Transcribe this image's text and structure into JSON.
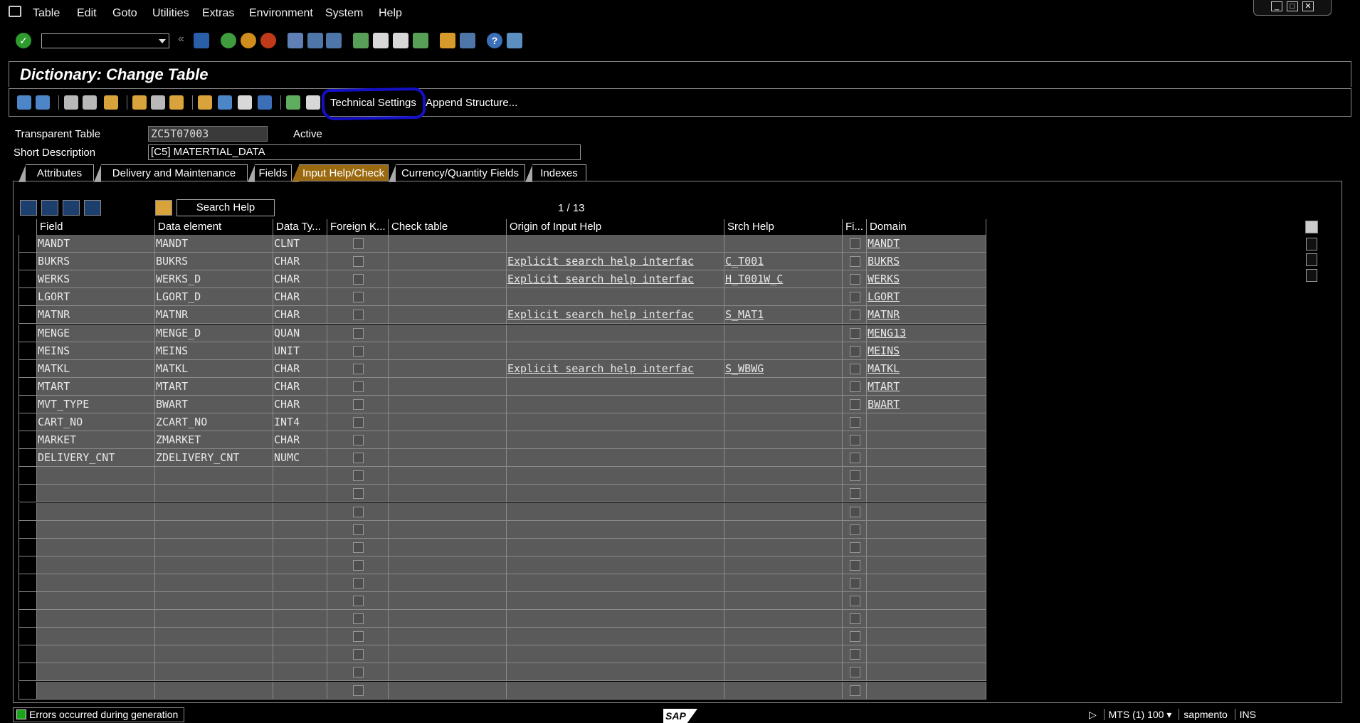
{
  "menu": {
    "items": [
      "Table",
      "Edit",
      "Goto",
      "Utilities",
      "Extras",
      "Environment",
      "System",
      "Help"
    ]
  },
  "title": "Dictionary: Change Table",
  "app_toolbar": {
    "technical_settings": "Technical Settings",
    "append_structure": "Append Structure..."
  },
  "header": {
    "transparent_table_label": "Transparent Table",
    "transparent_table_value": "ZC5T07003",
    "status": "Active",
    "short_description_label": "Short Description",
    "short_description_value": "[C5] MATERTIAL_DATA"
  },
  "tabs": [
    "Attributes",
    "Delivery and Maintenance",
    "Fields",
    "Input Help/Check",
    "Currency/Quantity Fields",
    "Indexes"
  ],
  "active_tab": "Input Help/Check",
  "table_toolbar": {
    "search_help": "Search Help",
    "pager": "1  /  13"
  },
  "columns": [
    "Field",
    "Data element",
    "Data Ty...",
    "Foreign K...",
    "Check table",
    "Origin of Input Help",
    "Srch Help",
    "Fi...",
    "Domain"
  ],
  "rows": [
    {
      "field": "MANDT",
      "data_element": "MANDT",
      "data_type": "CLNT",
      "check_table": "",
      "origin": "",
      "srch_help": "",
      "domain": "MANDT"
    },
    {
      "field": "BUKRS",
      "data_element": "BUKRS",
      "data_type": "CHAR",
      "check_table": "",
      "origin": "Explicit search help interfac",
      "srch_help": "C_T001",
      "domain": "BUKRS"
    },
    {
      "field": "WERKS",
      "data_element": "WERKS_D",
      "data_type": "CHAR",
      "check_table": "",
      "origin": "Explicit search help interfac",
      "srch_help": "H_T001W_C",
      "domain": "WERKS"
    },
    {
      "field": "LGORT",
      "data_element": "LGORT_D",
      "data_type": "CHAR",
      "check_table": "",
      "origin": "",
      "srch_help": "",
      "domain": "LGORT"
    },
    {
      "field": "MATNR",
      "data_element": "MATNR",
      "data_type": "CHAR",
      "check_table": "",
      "origin": "Explicit search help interfac",
      "srch_help": "S_MAT1",
      "domain": "MATNR"
    },
    {
      "field": "MENGE",
      "data_element": "MENGE_D",
      "data_type": "QUAN",
      "check_table": "",
      "origin": "",
      "srch_help": "",
      "domain": "MENG13"
    },
    {
      "field": "MEINS",
      "data_element": "MEINS",
      "data_type": "UNIT",
      "check_table": "",
      "origin": "",
      "srch_help": "",
      "domain": "MEINS"
    },
    {
      "field": "MATKL",
      "data_element": "MATKL",
      "data_type": "CHAR",
      "check_table": "",
      "origin": "Explicit search help interfac",
      "srch_help": "S_WBWG",
      "domain": "MATKL"
    },
    {
      "field": "MTART",
      "data_element": "MTART",
      "data_type": "CHAR",
      "check_table": "",
      "origin": "",
      "srch_help": "",
      "domain": "MTART"
    },
    {
      "field": "MVT_TYPE",
      "data_element": "BWART",
      "data_type": "CHAR",
      "check_table": "",
      "origin": "",
      "srch_help": "",
      "domain": "BWART"
    },
    {
      "field": "CART_NO",
      "data_element": "ZCART_NO",
      "data_type": "INT4",
      "check_table": "",
      "origin": "",
      "srch_help": "",
      "domain": ""
    },
    {
      "field": "MARKET",
      "data_element": "ZMARKET",
      "data_type": "CHAR",
      "check_table": "",
      "origin": "",
      "srch_help": "",
      "domain": ""
    },
    {
      "field": "DELIVERY_CNT",
      "data_element": "ZDELIVERY_CNT",
      "data_type": "NUMC",
      "check_table": "",
      "origin": "",
      "srch_help": "",
      "domain": ""
    }
  ],
  "empty_rows": 13,
  "status_bar": {
    "message": "Errors occurred during generation",
    "system": "MTS (1) 100",
    "server": "sapmento",
    "mode": "INS",
    "logo": "SAP"
  }
}
